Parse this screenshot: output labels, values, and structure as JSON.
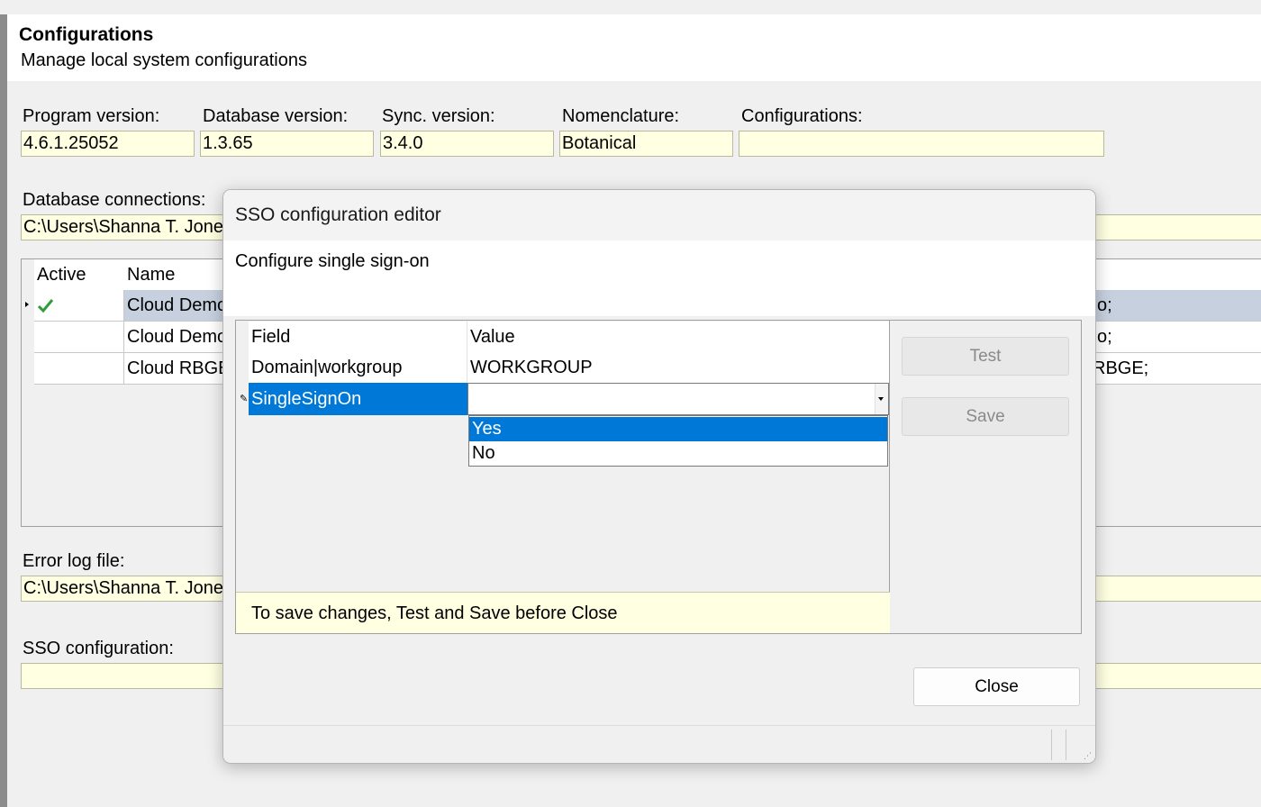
{
  "header": {
    "title": "Configurations",
    "subtitle": "Manage local system configurations"
  },
  "versions": {
    "program_label": "Program version:",
    "program_value": "4.6.1.25052",
    "database_label": "Database version:",
    "database_value": "1.3.65",
    "sync_label": "Sync. version:",
    "sync_value": "3.4.0",
    "nomenclature_label": "Nomenclature:",
    "nomenclature_value": "Botanical",
    "configurations_label": "Configurations:",
    "configurations_value": ""
  },
  "db_connections": {
    "label": "Database connections:",
    "value": "C:\\Users\\Shanna T. Jone",
    "columns": [
      "Active",
      "Name"
    ],
    "rows": [
      {
        "active_icon": "check-icon",
        "name": "Cloud Demo",
        "tail": "o;"
      },
      {
        "active_icon": "",
        "name": "Cloud Demo",
        "tail": "o;"
      },
      {
        "active_icon": "",
        "name": "Cloud RBGE",
        "tail": "RBGE;"
      }
    ]
  },
  "error_log": {
    "label": "Error log file:",
    "value": "C:\\Users\\Shanna T. Jone"
  },
  "sso_config": {
    "label": "SSO configuration:",
    "value": ""
  },
  "dialog": {
    "title": "SSO configuration editor",
    "description": "Configure single sign-on",
    "grid_columns": [
      "Field",
      "Value"
    ],
    "rows": [
      {
        "field": "Domain|workgroup",
        "value": "WORKGROUP"
      },
      {
        "field": "SingleSignOn",
        "value": ""
      }
    ],
    "dropdown_options": [
      "Yes",
      "No"
    ],
    "dropdown_highlighted": "Yes",
    "hint": "To save changes, Test and Save before Close",
    "test_label": "Test",
    "save_label": "Save",
    "close_label": "Close"
  },
  "colors": {
    "selection": "#0078d7",
    "field_background": "#ffffe1",
    "row_selected": "#c6d0de"
  }
}
